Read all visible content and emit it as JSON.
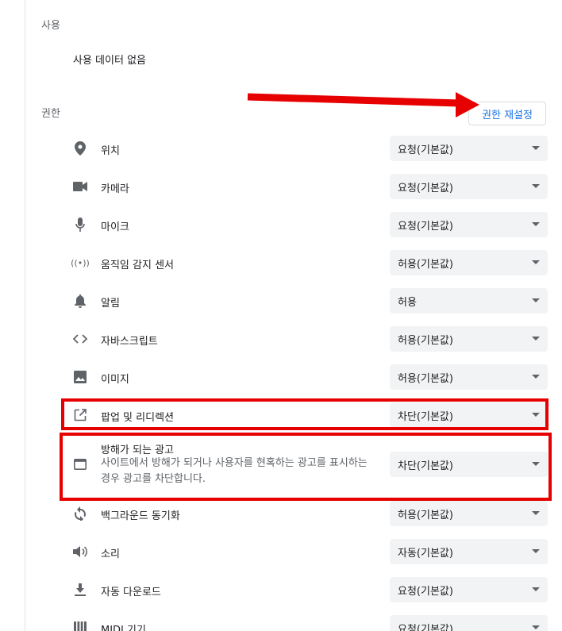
{
  "usage": {
    "heading": "사용",
    "text": "사용 데이터 없음"
  },
  "permissions": {
    "heading": "권한",
    "reset_label": "권한 재설정",
    "rows": [
      {
        "label": "위치",
        "value": "요청(기본값)",
        "icon": "location-pin-icon"
      },
      {
        "label": "카메라",
        "value": "요청(기본값)",
        "icon": "camera-icon"
      },
      {
        "label": "마이크",
        "value": "요청(기본값)",
        "icon": "microphone-icon"
      },
      {
        "label": "움직임 감지 센서",
        "value": "허용(기본값)",
        "icon": "motion-sensor-icon"
      },
      {
        "label": "알림",
        "value": "허용",
        "icon": "bell-icon"
      },
      {
        "label": "자바스크립트",
        "value": "허용(기본값)",
        "icon": "code-icon"
      },
      {
        "label": "이미지",
        "value": "허용(기본값)",
        "icon": "image-icon"
      },
      {
        "label": "팝업 및 리디렉션",
        "value": "차단(기본값)",
        "icon": "open-in-new-icon"
      },
      {
        "label": "방해가 되는 광고",
        "sublabel": "사이트에서 방해가 되거나 사용자를 현혹하는 광고를 표시하는 경우 광고를 차단합니다.",
        "value": "차단(기본값)",
        "icon": "browser-window-icon"
      },
      {
        "label": "백그라운드 동기화",
        "value": "허용(기본값)",
        "icon": "sync-icon"
      },
      {
        "label": "소리",
        "value": "자동(기본값)",
        "icon": "volume-icon"
      },
      {
        "label": "자동 다운로드",
        "value": "요청(기본값)",
        "icon": "download-icon"
      },
      {
        "label": "MIDI 기기",
        "value": "요청(기본값)",
        "icon": "piano-keys-icon"
      }
    ]
  },
  "colors": {
    "annotation": "#e60000",
    "accent": "#1a73e8",
    "select_bg": "#f1f3f4"
  }
}
